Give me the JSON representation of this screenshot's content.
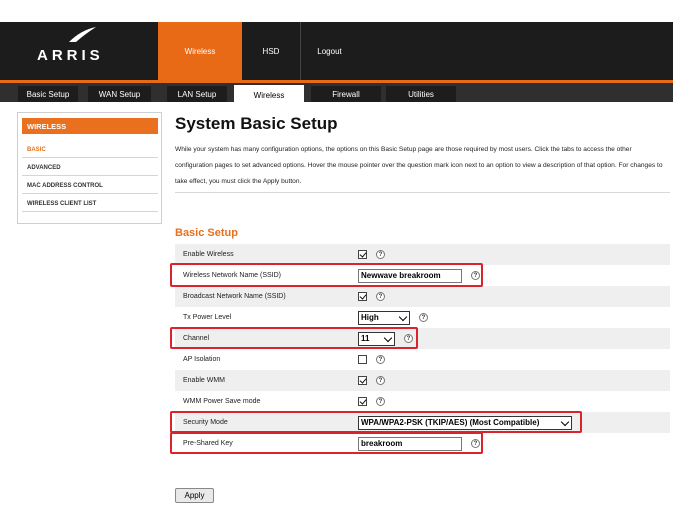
{
  "header": {
    "logo": "ARRIS",
    "top_nav": [
      {
        "label": "Wireless"
      },
      {
        "label": "HSD"
      },
      {
        "label": "Logout"
      }
    ]
  },
  "tabs": [
    {
      "label": "Basic Setup"
    },
    {
      "label": "WAN Setup"
    },
    {
      "label": "LAN Setup"
    },
    {
      "label": "Wireless"
    },
    {
      "label": "Firewall"
    },
    {
      "label": "Utilities"
    }
  ],
  "sidebar": {
    "heading": "WIRELESS",
    "items": [
      {
        "label": "BASIC"
      },
      {
        "label": "ADVANCED"
      },
      {
        "label": "MAC ADDRESS CONTROL"
      },
      {
        "label": "WIRELESS CLIENT LIST"
      }
    ]
  },
  "main": {
    "title": "System Basic Setup",
    "description": "While your system has many configuration options, the options on this Basic Setup page are those required by most users. Click the tabs to access the other configuration pages to set advanced options. Hover the mouse pointer over the question mark icon next to an option to view a description of that option. For changes to take effect, you must click the Apply button.",
    "section_title": "Basic Setup",
    "help_glyph": "?",
    "rows": [
      {
        "label": "Enable Wireless",
        "checked": true
      },
      {
        "label": "Wireless Network Name (SSID)",
        "value": "Newwave breakroom"
      },
      {
        "label": "Broadcast Network Name (SSID)",
        "checked": true
      },
      {
        "label": "Tx Power Level",
        "value": "High"
      },
      {
        "label": "Channel",
        "value": "11"
      },
      {
        "label": "AP Isolation",
        "checked": false
      },
      {
        "label": "Enable WMM",
        "checked": true
      },
      {
        "label": "WMM Power Save mode",
        "checked": true
      },
      {
        "label": "Security Mode",
        "value": "WPA/WPA2-PSK (TKIP/AES) (Most Compatible)"
      },
      {
        "label": "Pre-Shared Key",
        "value": "breakroom"
      }
    ],
    "apply_label": "Apply"
  },
  "colors": {
    "accent": "#e8701e",
    "header_bg": "#1c1c1c",
    "highlight": "#d9232d"
  }
}
